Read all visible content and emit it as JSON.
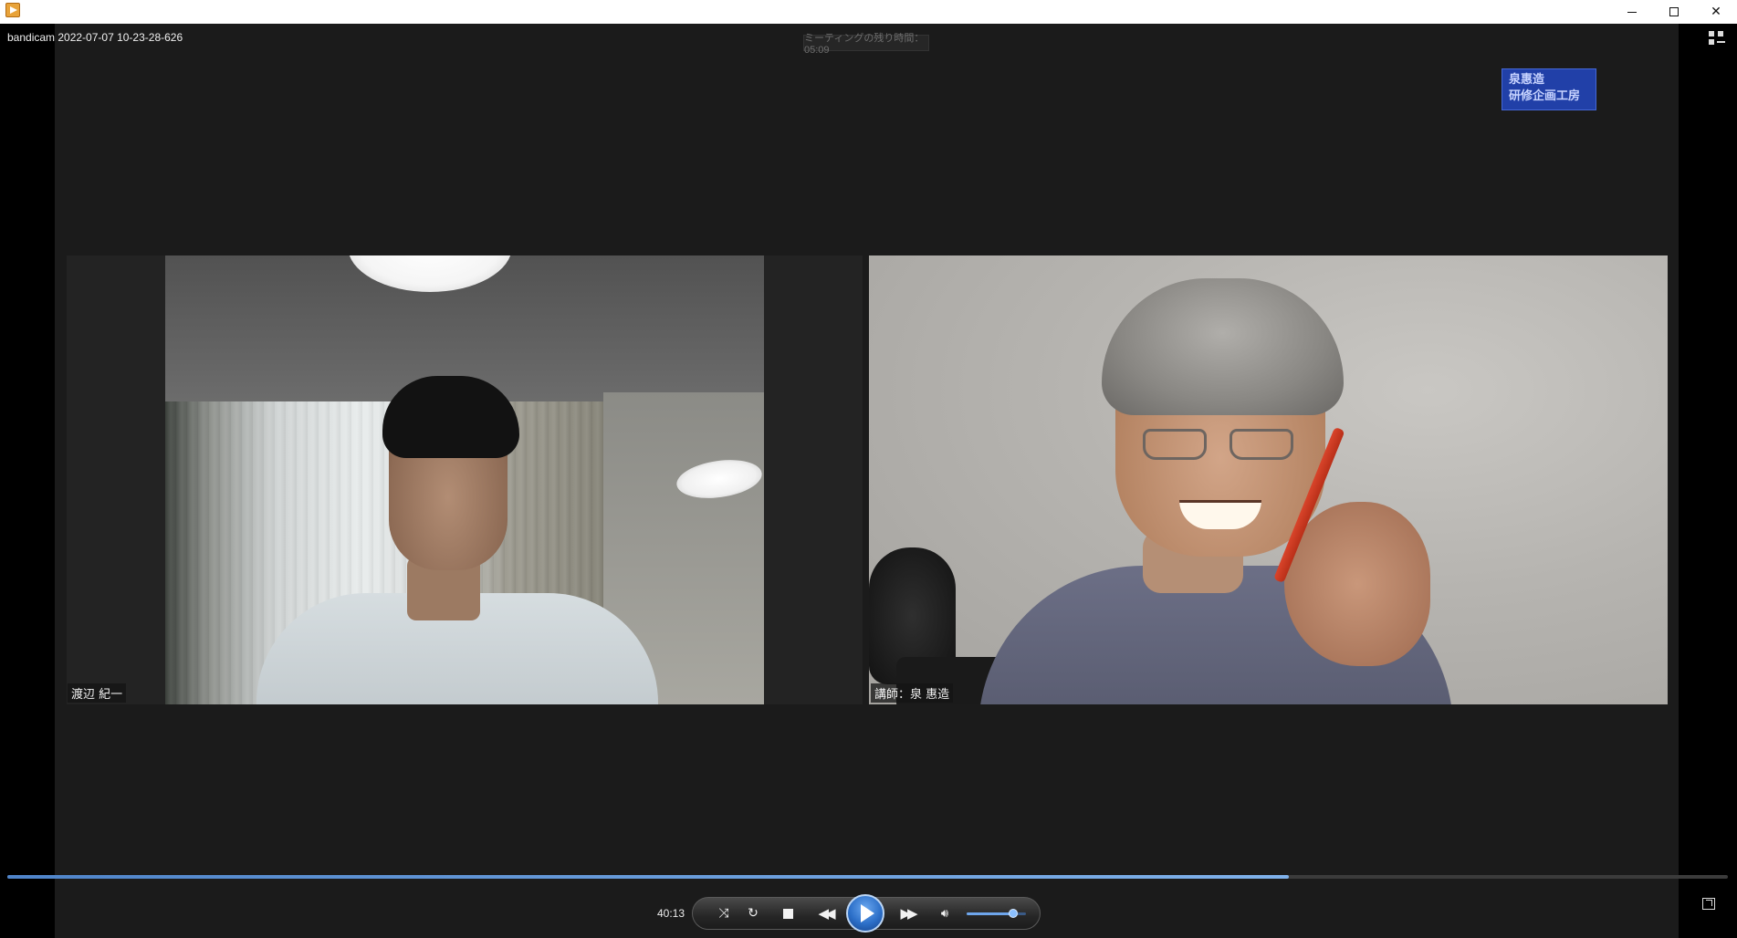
{
  "window": {
    "file_name": "bandicam 2022-07-07 10-23-28-626"
  },
  "meeting": {
    "remaining_time_text": "ミーティングの残り時間：05:09",
    "logo_line1": "泉惠造",
    "logo_line2": "研修企画工房"
  },
  "participants": [
    {
      "name": "渡辺 紀一"
    },
    {
      "name": "講師：泉 惠造"
    }
  ],
  "player": {
    "elapsed_time": "40:13",
    "progress_fraction": 0.745,
    "volume_fraction": 0.78
  },
  "icons": {
    "title": "media-player-app-icon",
    "minimize": "minimize-icon",
    "maximize": "maximize-icon",
    "close": "close-icon",
    "layout": "layout-toggle-icon",
    "shuffle": "shuffle-icon",
    "repeat": "repeat-icon",
    "stop": "stop-icon",
    "previous": "previous-icon",
    "play": "play-icon",
    "next": "next-icon",
    "volume": "volume-icon",
    "switch": "switch-to-library-icon"
  },
  "colors": {
    "accent": "#2c6fc8",
    "logo_bg": "#2140a8"
  }
}
